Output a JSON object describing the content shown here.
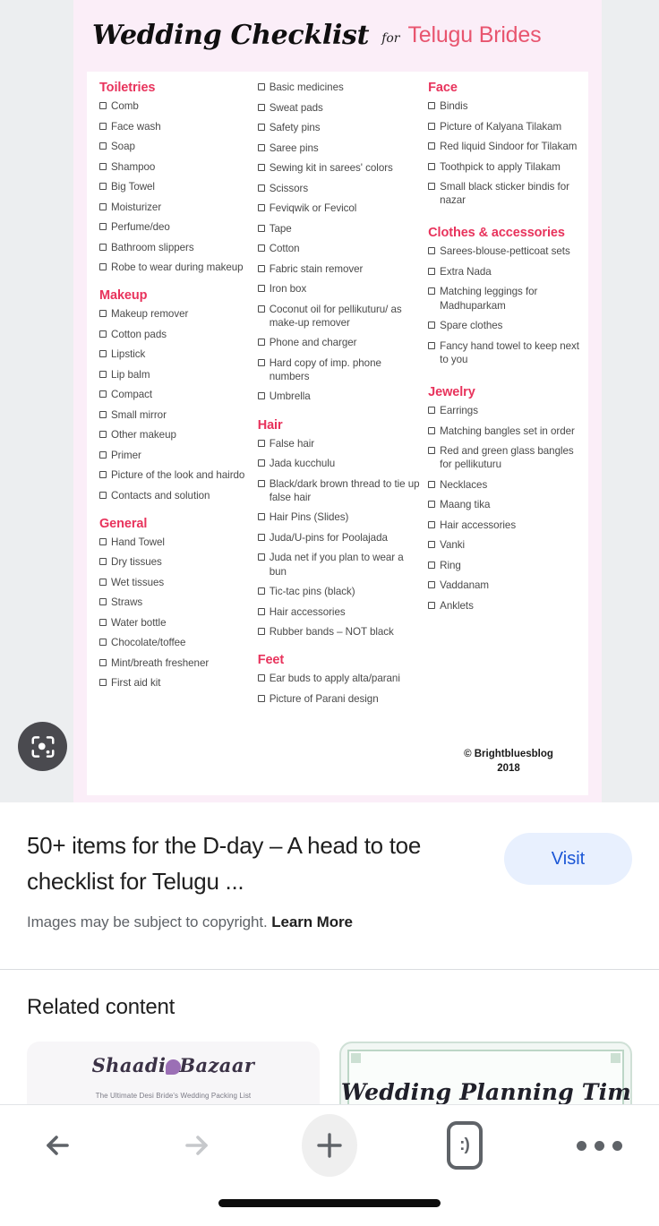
{
  "poster": {
    "title_script": "Wedding Checklist",
    "title_for": "for",
    "title_highlight": "Telugu Brides",
    "copyright": "© Brightbluesblog",
    "copyright_year": "2018",
    "accent_pink": "#e8335c",
    "bg_pink": "#fbeef8",
    "columns": [
      {
        "sections": [
          {
            "heading": "Toiletries",
            "items": [
              "Comb",
              "Face wash",
              "Soap",
              "Shampoo",
              "Big Towel",
              "Moisturizer",
              "Perfume/deo",
              "Bathroom slippers",
              "Robe to wear during makeup"
            ]
          },
          {
            "heading": "Makeup",
            "items": [
              "Makeup remover",
              "Cotton pads",
              "Lipstick",
              "Lip balm",
              "Compact",
              "Small mirror",
              "Other makeup",
              "Primer",
              "Picture of the look and hairdo",
              "Contacts and solution"
            ]
          },
          {
            "heading": "General",
            "items": [
              "Hand Towel",
              "Dry tissues",
              "Wet tissues",
              "Straws",
              "Water bottle",
              "Chocolate/toffee",
              "Mint/breath freshener",
              "First aid kit"
            ]
          }
        ]
      },
      {
        "sections": [
          {
            "heading": "",
            "items": [
              "Basic medicines",
              "Sweat pads",
              "Safety pins",
              "Saree pins",
              "Sewing kit in sarees' colors",
              "Scissors",
              "Feviqwik or Fevicol",
              "Tape",
              "Cotton",
              "Fabric stain remover",
              "Iron box",
              "Coconut oil for pellikuturu/ as make-up remover",
              "Phone and charger",
              "Hard copy of imp. phone numbers",
              "Umbrella"
            ]
          },
          {
            "heading": "Hair",
            "items": [
              "False hair",
              "Jada kucchulu",
              "Black/dark brown thread to tie up false hair",
              "Hair Pins (Slides)",
              "Juda/U-pins for Poolajada",
              "Juda net if you plan to wear a bun",
              "Tic-tac pins (black)",
              "Hair accessories",
              "Rubber bands – NOT black"
            ]
          },
          {
            "heading": "Feet",
            "items": [
              "Ear buds to apply alta/parani",
              "Picture of Parani design"
            ]
          }
        ]
      },
      {
        "sections": [
          {
            "heading": "Face",
            "items": [
              "Bindis",
              "Picture of Kalyana Tilakam",
              "Red liquid Sindoor for Tilakam",
              "Toothpick to apply Tilakam",
              "Small black sticker bindis for nazar"
            ]
          },
          {
            "heading": "Clothes & accessories",
            "items": [
              "Sarees-blouse-petticoat sets",
              "Extra Nada",
              "Matching leggings for Madhuparkam",
              "Spare clothes",
              "Fancy hand towel to keep next to you"
            ]
          },
          {
            "heading": "Jewelry",
            "items": [
              "Earrings",
              "Matching bangles set in order",
              "Red and green glass bangles for pellikuturu",
              "Necklaces",
              "Maang tika",
              "Hair accessories",
              "Vanki",
              "Ring",
              "Vaddanam",
              "Anklets"
            ]
          }
        ]
      }
    ]
  },
  "lens": {
    "icon": "google-lens-icon"
  },
  "result": {
    "title": "50+ items for the D-day – A head to toe checklist for Telugu ...",
    "visit_label": "Visit",
    "copyright_note": "Images may be subject to copyright.",
    "learn_more": "Learn More",
    "visit_text_color": "#1a56d6",
    "visit_bg_color": "#e8f0fe"
  },
  "related": {
    "heading": "Related content",
    "thumbnails": [
      {
        "title": "Shaadi Bazaar",
        "subtitle": "The Ultimate Desi Bride's Wedding Packing List"
      },
      {
        "title": "Wedding Planning Timeline",
        "subtitle": ""
      }
    ]
  },
  "navbar": {
    "back": "back-arrow",
    "forward": "forward-arrow",
    "new_tab": "plus",
    "tabs": ":)",
    "menu": "more-options"
  }
}
